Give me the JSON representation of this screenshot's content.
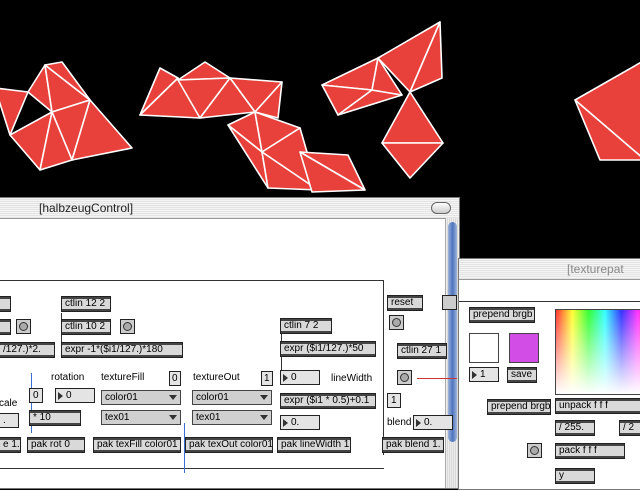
{
  "colors": {
    "triangle_fill": "#e8403a",
    "triangle_stroke": "#ffffff",
    "background": "#000000",
    "purple_swatch": "#d24de6"
  },
  "main_window": {
    "title": "[halbzeugControl]",
    "objects": {
      "ctlin_12": "ctlin 12 2",
      "ctlin_10": "ctlin 10 2",
      "expr_neg": "expr -1*($i1/127.)*180",
      "expr_left": "/127.)*2.",
      "ctlin_7": "ctlin 7 2",
      "expr_50": "expr ($i1/127.)*50",
      "expr_half": "expr ($i1 * 0.5)+0.1",
      "reset": "reset",
      "ctlin_27": "ctlin 27 1",
      "mult10": "* 10",
      "pak_rot": "pak rot 0",
      "pak_texfill": "pak texFill color01",
      "pak_texout": "pak texOut color01",
      "pak_linewidth": "pak lineWidth 1.",
      "pak_blend": "pak blend 1.",
      "pak_left": "e 1."
    },
    "labels": {
      "rotation": "rotation",
      "texture_fill": "textureFill",
      "texture_out": "textureOut",
      "line_width": "lineWidth",
      "blend": "blend",
      "scale": "cale"
    },
    "numbers": {
      "n0_rot": "0",
      "n0_small": "0",
      "n_fill": "0",
      "n_out": "1",
      "n_linewidth": "0",
      "n_linewidth2": "0.",
      "n_blend": "0.",
      "n_one": "1",
      "n_left": "."
    },
    "menus": {
      "fill_color": "color01",
      "fill_tex": "tex01",
      "out_color": "color01",
      "out_tex": "tex01"
    }
  },
  "tex_window": {
    "title": "[texturepat",
    "objects": {
      "prepend1": "prepend brgb",
      "prepend2": "prepend brgb",
      "unpack": "unpack f f f",
      "div1": "/ 255.",
      "div2": "/ 2",
      "pack": "pack f f f",
      "save": "save",
      "y": "y"
    },
    "numbers": {
      "n1": "1"
    }
  }
}
